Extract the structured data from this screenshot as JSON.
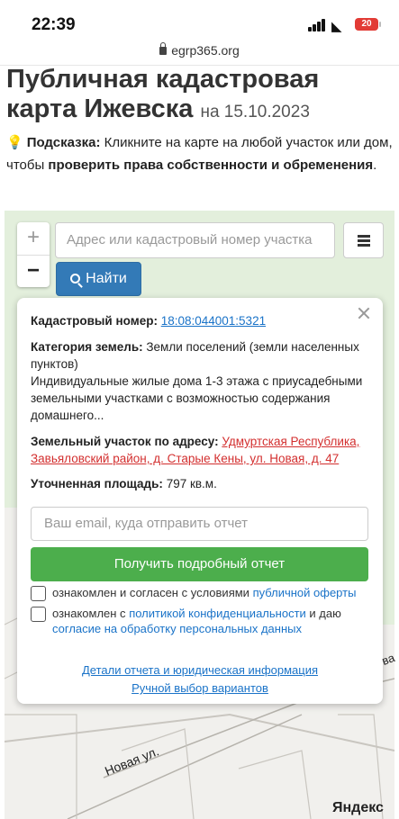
{
  "status_bar": {
    "time": "22:39",
    "url": "egrp365.org",
    "battery": "20"
  },
  "page": {
    "title": "Публичная кадастровая карта Ижевска",
    "date": "на 15.10.2023"
  },
  "hint": {
    "label": "Подсказка:",
    "text_1": "Кликните на карте на любой участок или дом, чтобы",
    "text_bold": "проверить права собственности и обременения",
    "text_2": "."
  },
  "map_controls": {
    "zoom_in": "+",
    "zoom_out": "−",
    "search_placeholder": "Адрес или кадастровый номер участка",
    "find_label": "Найти"
  },
  "popup": {
    "cadastral_label": "Кадастровый номер:",
    "cadastral_value": "18:08:044001:5321",
    "category_label": "Категория земель:",
    "category_value": "Земли поселений (земли населенных пунктов)",
    "usage_text": "Индивидуальные жилые дома 1-3 этажа с приусадебными земельными участками с возможностью содержания домашнего...",
    "address_label": "Земельный участок по адресу:",
    "address_value": "Удмуртская Республика, Завьяловский район, д. Старые Кены, ул. Новая, д. 47",
    "area_label": "Уточненная площадь:",
    "area_value": "797 кв.м.",
    "email_placeholder": "Ваш email, куда отправить отчет",
    "report_button": "Получить подробный отчет",
    "check1_text": "ознакомлен и согласен с условиями",
    "check1_link": "публичной оферты",
    "check2_text_a": "ознакомлен с",
    "check2_link_a": "политикой конфиденциальности",
    "check2_text_b": "и даю",
    "check2_link_b": "согласие на обработку персональных данных",
    "details_link": "Детали отчета и юридическая информация",
    "manual_link": "Ручной выбор вариантов"
  },
  "map": {
    "street_label": "Новая ул.",
    "edge_label": "ва",
    "copyright_brand": "Яндекс"
  }
}
